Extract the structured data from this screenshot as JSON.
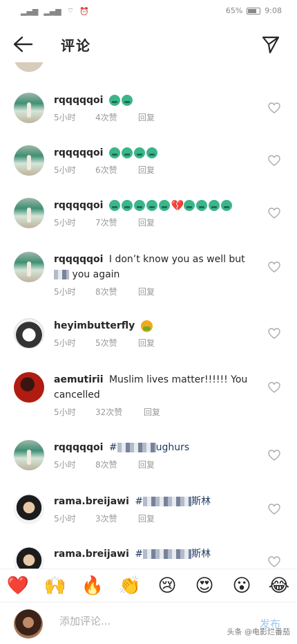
{
  "status_bar": {
    "battery": "65%",
    "time": "9:08"
  },
  "header": {
    "title": "评论"
  },
  "comments": [
    {
      "username": "rqqqqqoi",
      "text": "",
      "time": "5小时",
      "likes": "4次赞",
      "reply": "回复",
      "emoji_count": 2
    },
    {
      "username": "rqqqqqoi",
      "text": "",
      "time": "5小时",
      "likes": "6次赞",
      "reply": "回复",
      "emoji_count": 4
    },
    {
      "username": "rqqqqqoi",
      "text": "",
      "time": "5小时",
      "likes": "7次赞",
      "reply": "回复",
      "emoji_count": 9
    },
    {
      "username": "rqqqqqoi",
      "text": "I don’t know you as well but",
      "text2": "you again",
      "time": "5小时",
      "likes": "8次赞",
      "reply": "回复"
    },
    {
      "username": "heyimbutterfly",
      "text": "",
      "time": "5小时",
      "likes": "5次赞",
      "reply": "回复"
    },
    {
      "username": "aemutirii",
      "text": "Muslim lives matter!!!!!! You",
      "text2": "cancelled",
      "time": "5小时",
      "likes": "32次赞",
      "reply": "回复"
    },
    {
      "username": "rqqqqqoi",
      "text": "#",
      "text_tail": "ughurs",
      "time": "5小时",
      "likes": "8次赞",
      "reply": "回复"
    },
    {
      "username": "rama.breijawi",
      "text": "#",
      "text_tail": "斯林",
      "time": "5小时",
      "likes": "3次赞",
      "reply": "回复"
    },
    {
      "username": "rama.breijawi",
      "text": "#",
      "text_tail": "斯林"
    }
  ],
  "reactions": [
    "❤️",
    "🙌",
    "🔥",
    "👏",
    "😢",
    "😍",
    "😮",
    "😂"
  ],
  "input": {
    "placeholder": "添加评论...",
    "post_label": "发布"
  },
  "watermark": "头条 @电影烂番茄"
}
